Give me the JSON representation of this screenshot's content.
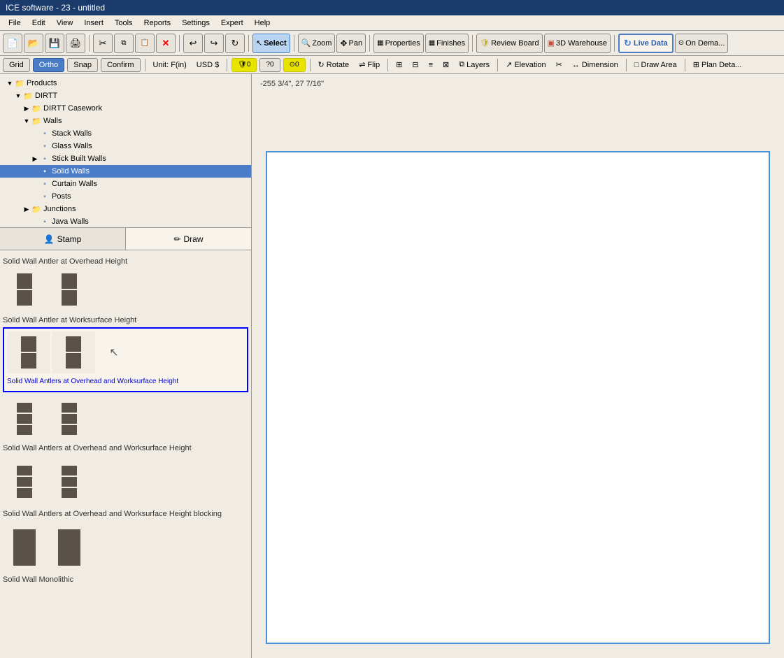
{
  "title_bar": {
    "text": "ICE software - 23 - untitled"
  },
  "menu": {
    "items": [
      "File",
      "Edit",
      "View",
      "Insert",
      "Tools",
      "Reports",
      "Settings",
      "Expert",
      "Help"
    ]
  },
  "toolbar": {
    "buttons": [
      {
        "id": "new",
        "icon": "📄",
        "tooltip": "New"
      },
      {
        "id": "open",
        "icon": "📂",
        "tooltip": "Open"
      },
      {
        "id": "save",
        "icon": "💾",
        "tooltip": "Save"
      },
      {
        "id": "print",
        "icon": "🖨",
        "tooltip": "Print"
      },
      {
        "id": "cut",
        "icon": "✂",
        "tooltip": "Cut"
      },
      {
        "id": "copy",
        "icon": "⧉",
        "tooltip": "Copy"
      },
      {
        "id": "paste",
        "icon": "📋",
        "tooltip": "Paste"
      },
      {
        "id": "delete",
        "icon": "✕",
        "tooltip": "Delete",
        "color": "red"
      },
      {
        "id": "undo",
        "icon": "↩",
        "tooltip": "Undo"
      },
      {
        "id": "redo",
        "icon": "↪",
        "tooltip": "Redo"
      },
      {
        "id": "refresh",
        "icon": "↻",
        "tooltip": "Refresh"
      }
    ],
    "select_label": "Select",
    "zoom_label": "Zoom",
    "pan_label": "Pan",
    "properties_label": "Properties",
    "finishes_label": "Finishes",
    "review_board_label": "Review Board",
    "warehouse_label": "3D Warehouse",
    "live_data_label": "Live Data",
    "on_demand_label": "On Dema..."
  },
  "nav_bar": {
    "grid_label": "Grid",
    "ortho_label": "Ortho",
    "snap_label": "Snap",
    "confirm_label": "Confirm",
    "unit_label": "Unit: F(in)",
    "usd_label": "USD $",
    "badge1": "0",
    "badge2": "0",
    "badge3": "0",
    "rotate_label": "Rotate",
    "flip_label": "Flip",
    "layers_label": "Layers",
    "elevation_label": "Elevation",
    "dimension_label": "Dimension",
    "draw_area_label": "Draw Area",
    "plan_detail_label": "Plan Deta..."
  },
  "coord_display": "-255 3/4\", 27 7/16\"",
  "tree": {
    "items": [
      {
        "id": "products",
        "label": "Products",
        "level": 0,
        "type": "root",
        "expanded": true
      },
      {
        "id": "dirtt",
        "label": "DIRTT",
        "level": 1,
        "type": "folder",
        "expanded": true
      },
      {
        "id": "dirtt-casework",
        "label": "DIRTT Casework",
        "level": 2,
        "type": "folder",
        "expanded": false
      },
      {
        "id": "walls",
        "label": "Walls",
        "level": 2,
        "type": "folder",
        "expanded": true
      },
      {
        "id": "stack-walls",
        "label": "Stack Walls",
        "level": 3,
        "type": "item"
      },
      {
        "id": "glass-walls",
        "label": "Glass Walls",
        "level": 3,
        "type": "item"
      },
      {
        "id": "stick-built-walls",
        "label": "Stick Built Walls",
        "level": 3,
        "type": "folder",
        "expanded": false
      },
      {
        "id": "solid-walls",
        "label": "Solid Walls",
        "level": 3,
        "type": "item",
        "selected": true
      },
      {
        "id": "curtain-walls",
        "label": "Curtain Walls",
        "level": 3,
        "type": "item"
      },
      {
        "id": "posts",
        "label": "Posts",
        "level": 3,
        "type": "item"
      },
      {
        "id": "junctions",
        "label": "Junctions",
        "level": 2,
        "type": "folder",
        "expanded": false
      },
      {
        "id": "java-walls",
        "label": "Java Walls",
        "level": 3,
        "type": "item"
      }
    ]
  },
  "stamp_draw": {
    "stamp_label": "Stamp",
    "draw_label": "Draw"
  },
  "product_panel": {
    "groups": [
      {
        "id": "overhead",
        "title": "Solid Wall Antler at Overhead Height",
        "tiles": [
          {
            "id": "oh1",
            "cols": 2,
            "selected": false
          },
          {
            "id": "oh2",
            "cols": 2,
            "selected": false
          }
        ]
      },
      {
        "id": "worksurface",
        "title": "Solid Wall Antler at Worksurface Height",
        "tiles": [
          {
            "id": "ws1",
            "cols": 2,
            "selected": false
          },
          {
            "id": "ws2",
            "cols": 2,
            "selected": false
          }
        ],
        "selected_group": true
      },
      {
        "id": "both",
        "title": "Solid Wall Antlers at Overhead and Worksurface Height",
        "tiles": [
          {
            "id": "b1",
            "cols": 2,
            "selected": false
          },
          {
            "id": "b2",
            "cols": 2,
            "selected": false
          }
        ]
      },
      {
        "id": "blocking",
        "title": "Solid Wall Antlers at Overhead and Worksurface Height blocking",
        "tiles": [
          {
            "id": "bl1",
            "cols": 2,
            "selected": false
          },
          {
            "id": "bl2",
            "cols": 2,
            "selected": false
          }
        ]
      },
      {
        "id": "monolithic",
        "title": "Solid Wall Monolithic",
        "tiles": []
      }
    ]
  }
}
